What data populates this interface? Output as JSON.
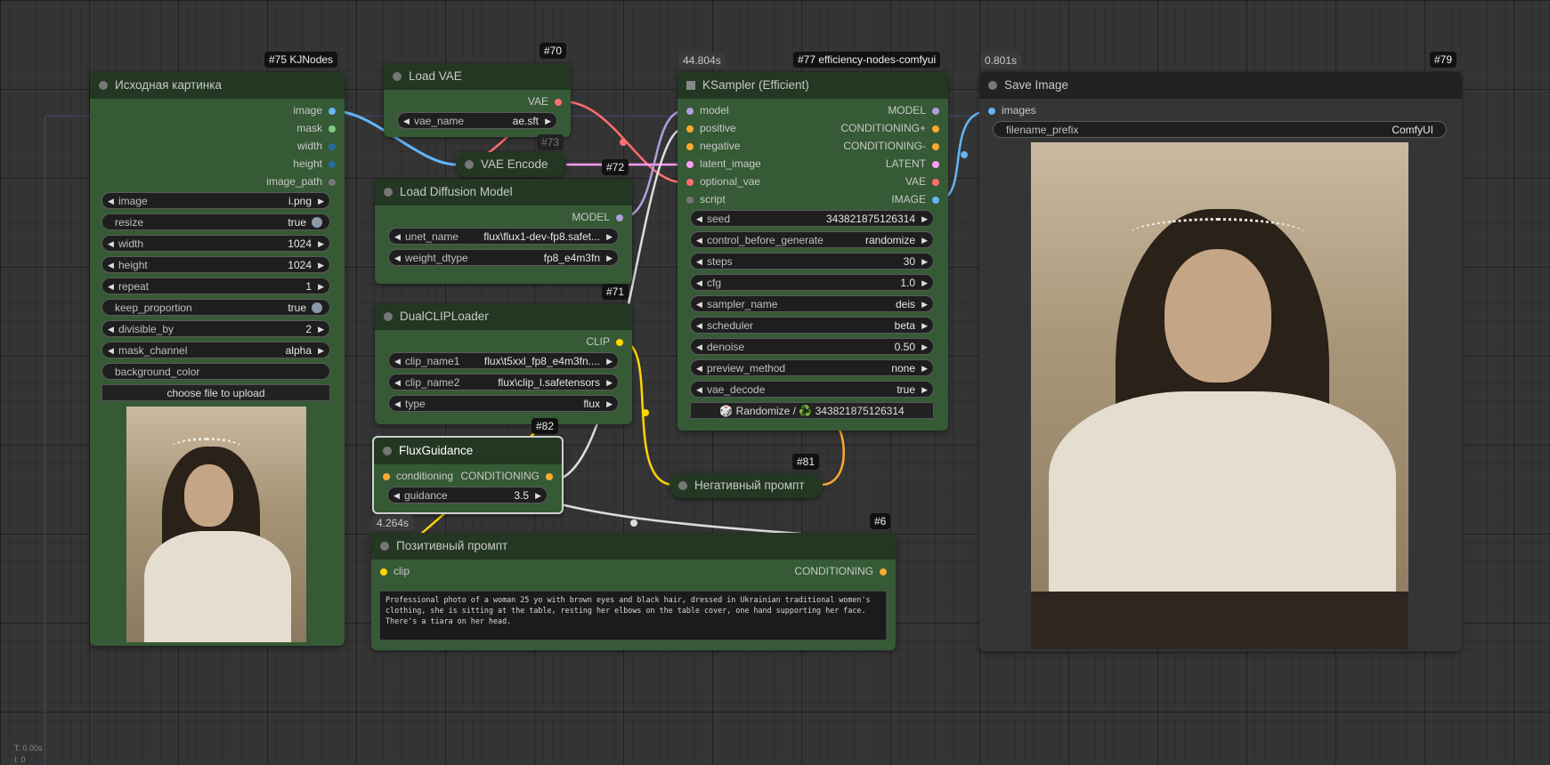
{
  "colors": {
    "image": "#64b5f6",
    "mask": "#81c784",
    "int": "#29699c",
    "string": "#777777",
    "vae": "#ff6e6e",
    "model": "#b39ddb",
    "conditioning": "#ffa931",
    "latent": "#ff9cf9",
    "clip": "#ffd500",
    "script": "#777777"
  },
  "nodes": {
    "load_image": {
      "title": "Исходная картинка",
      "badge": "#75 KJNodes",
      "outputs": [
        "image",
        "mask",
        "width",
        "height",
        "image_path"
      ],
      "widgets": {
        "image": {
          "label": "image",
          "value": "i.png"
        },
        "resize": {
          "label": "resize",
          "value": "true"
        },
        "width": {
          "label": "width",
          "value": "1024"
        },
        "height": {
          "label": "height",
          "value": "1024"
        },
        "repeat": {
          "label": "repeat",
          "value": "1"
        },
        "keep_proportion": {
          "label": "keep_proportion",
          "value": "true"
        },
        "divisible_by": {
          "label": "divisible_by",
          "value": "2"
        },
        "mask_channel": {
          "label": "mask_channel",
          "value": "alpha"
        },
        "background_color": {
          "label": "background_color"
        }
      },
      "upload_button": "choose file to upload"
    },
    "load_vae": {
      "title": "Load VAE",
      "badge": "#70",
      "output": "VAE",
      "vae_name": {
        "label": "vae_name",
        "value": "ae.sft"
      }
    },
    "vae_encode": {
      "title": "VAE Encode",
      "badge": "#72",
      "hidden_badge": "#73"
    },
    "load_diffusion": {
      "title": "Load Diffusion Model",
      "output": "MODEL",
      "badge": "#71",
      "unet_name": {
        "label": "unet_name",
        "value": "flux\\flux1-dev-fp8.safet..."
      },
      "weight_dtype": {
        "label": "weight_dtype",
        "value": "fp8_e4m3fn"
      }
    },
    "dual_clip": {
      "title": "DualCLIPLoader",
      "output": "CLIP",
      "clip_name1": {
        "label": "clip_name1",
        "value": "flux\\t5xxl_fp8_e4m3fn...."
      },
      "clip_name2": {
        "label": "clip_name2",
        "value": "flux\\clip_l.safetensors"
      },
      "type": {
        "label": "type",
        "value": "flux"
      }
    },
    "flux_guidance": {
      "title": "FluxGuidance",
      "badge": "#82",
      "time": "4.264s",
      "input": "conditioning",
      "output": "CONDITIONING",
      "guidance": {
        "label": "guidance",
        "value": "3.5"
      }
    },
    "ksampler": {
      "title": "KSampler (Efficient)",
      "badge": "#77 efficiency-nodes-comfyui",
      "time": "44.804s",
      "inputs": [
        "model",
        "positive",
        "negative",
        "latent_image",
        "optional_vae",
        "script"
      ],
      "outputs": [
        "MODEL",
        "CONDITIONING+",
        "CONDITIONING-",
        "LATENT",
        "VAE",
        "IMAGE"
      ],
      "widgets": {
        "seed": {
          "label": "seed",
          "value": "343821875126314"
        },
        "control": {
          "label": "control_before_generate",
          "value": "randomize"
        },
        "steps": {
          "label": "steps",
          "value": "30"
        },
        "cfg": {
          "label": "cfg",
          "value": "1.0"
        },
        "sampler_name": {
          "label": "sampler_name",
          "value": "deis"
        },
        "scheduler": {
          "label": "scheduler",
          "value": "beta"
        },
        "denoise": {
          "label": "denoise",
          "value": "0.50"
        },
        "preview_method": {
          "label": "preview_method",
          "value": "none"
        },
        "vae_decode": {
          "label": "vae_decode",
          "value": "true"
        }
      },
      "randomize_button": "🎲 Randomize / ♻️ 343821875126314"
    },
    "negative": {
      "title": "Негативный промпт",
      "badge": "#81"
    },
    "positive": {
      "title": "Позитивный промпт",
      "badge": "#6",
      "input": "clip",
      "output": "CONDITIONING",
      "text": "Professional photo of a woman 25 yo with brown eyes and black hair, dressed in Ukrainian traditional women's clothing, she is sitting at the table, resting her elbows on the table cover, one hand supporting her face. There's a tiara on her head."
    },
    "save_image": {
      "title": "Save Image",
      "badge": "#79",
      "time": "0.801s",
      "input": "images",
      "filename_prefix": {
        "label": "filename_prefix",
        "value": "ComfyUI"
      }
    }
  },
  "footer": {
    "line1": "T: 0.00s",
    "line2": "I: 0"
  }
}
